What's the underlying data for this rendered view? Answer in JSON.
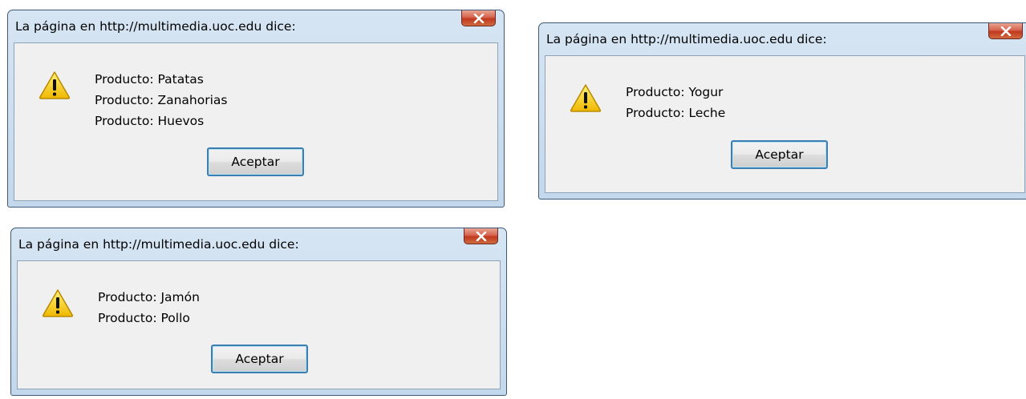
{
  "dialogs": [
    {
      "title": "La página en http://multimedia.uoc.edu dice:",
      "close_label": "x",
      "icon": "warning-icon",
      "lines": [
        "Producto: Patatas",
        "Producto: Zanahorias",
        "Producto: Huevos"
      ],
      "ok_label": "Aceptar"
    },
    {
      "title": "La página en http://multimedia.uoc.edu dice:",
      "close_label": "x",
      "icon": "warning-icon",
      "lines": [
        "Producto: Yogur",
        "Producto: Leche"
      ],
      "ok_label": "Aceptar"
    },
    {
      "title": "La página en http://multimedia.uoc.edu dice:",
      "close_label": "x",
      "icon": "warning-icon",
      "lines": [
        "Producto: Jamón",
        "Producto: Pollo"
      ],
      "ok_label": "Aceptar"
    }
  ],
  "colors": {
    "frame": "#c3d8ec",
    "close_button": "#c7432a",
    "ok_border": "#3c7fb1",
    "warning_yellow": "#f5c400"
  }
}
